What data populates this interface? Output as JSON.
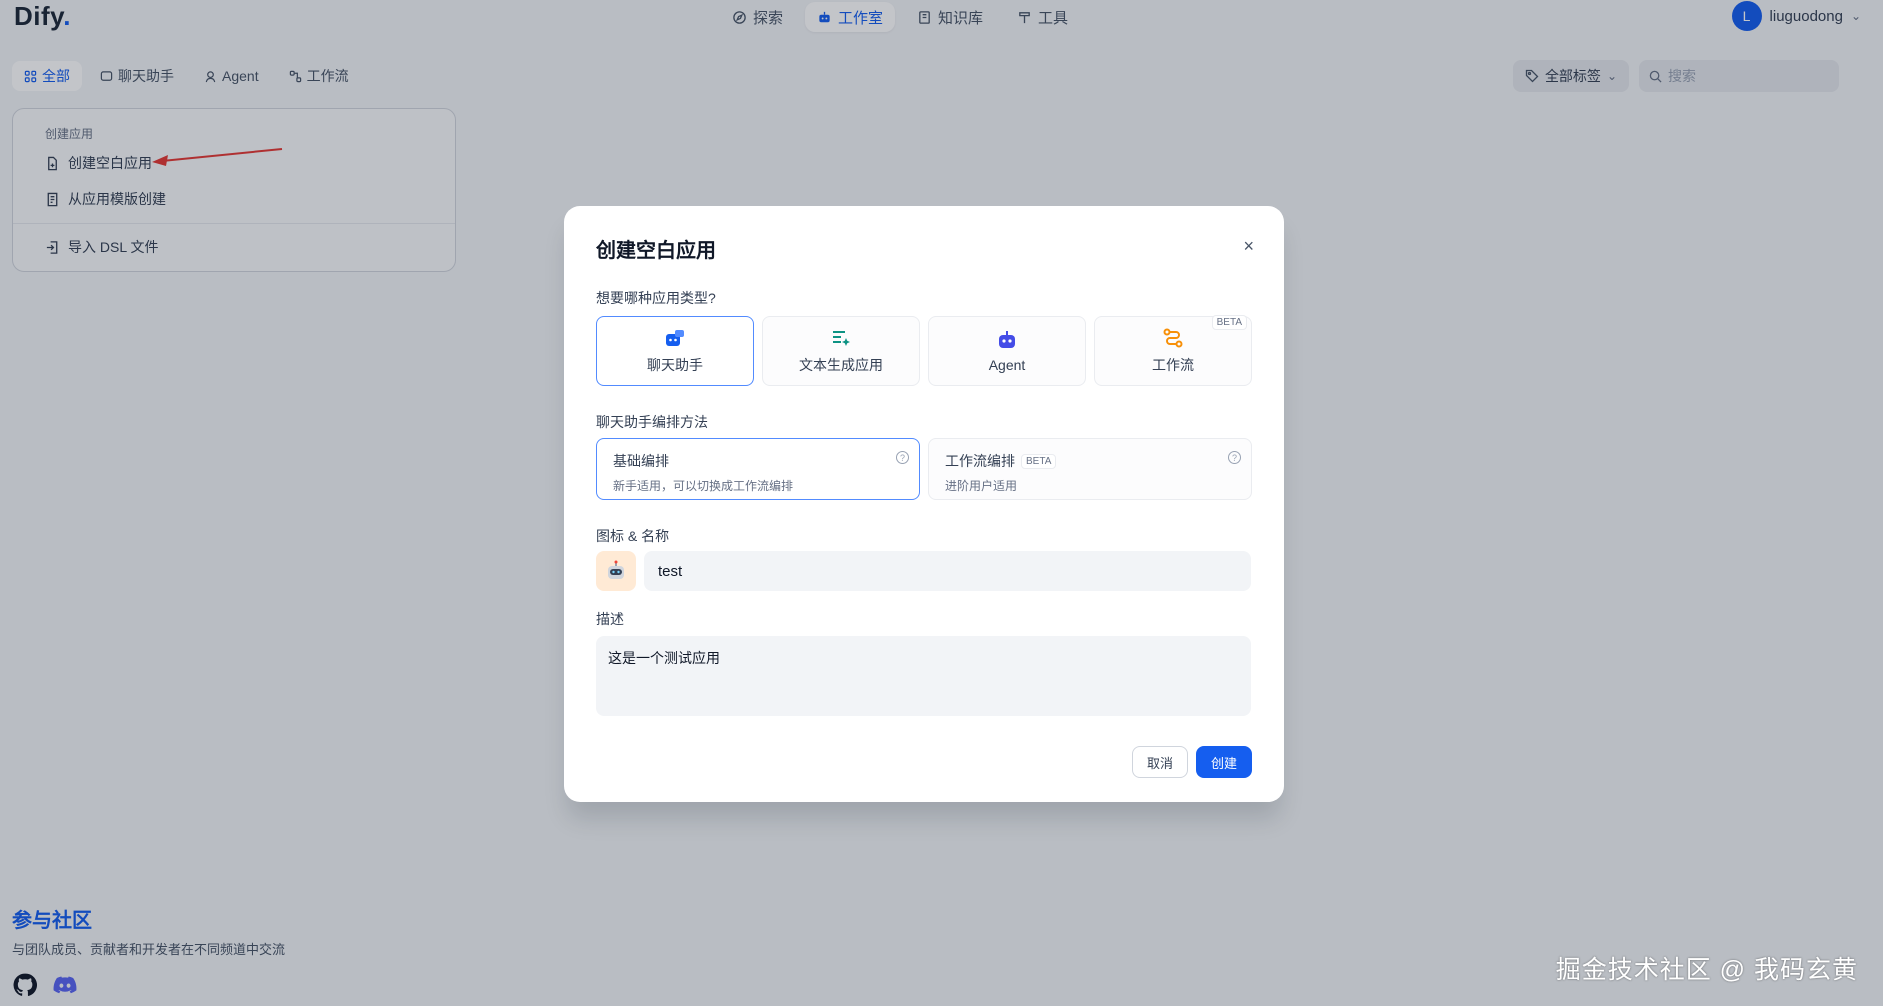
{
  "app": {
    "logo_text": "Dify",
    "logo_dot": "."
  },
  "nav": {
    "items": [
      {
        "label": "探索",
        "icon": "compass-icon"
      },
      {
        "label": "工作室",
        "icon": "robot-icon",
        "active": true
      },
      {
        "label": "知识库",
        "icon": "book-icon"
      },
      {
        "label": "工具",
        "icon": "hammer-icon"
      }
    ]
  },
  "user": {
    "initial": "L",
    "name": "liuguodong"
  },
  "tabs": [
    {
      "label": "全部",
      "active": true
    },
    {
      "label": "聊天助手"
    },
    {
      "label": "Agent"
    },
    {
      "label": "工作流"
    }
  ],
  "filters": {
    "tag_label": "全部标签",
    "search_placeholder": "搜索"
  },
  "create_card": {
    "title": "创建应用",
    "items": [
      "创建空白应用",
      "从应用模版创建",
      "导入 DSL 文件"
    ]
  },
  "community": {
    "title": "参与社区",
    "subtitle": "与团队成员、贡献者和开发者在不同频道中交流"
  },
  "watermark": "掘金技术社区 @ 我码玄黄",
  "modal": {
    "title": "创建空白应用",
    "close": "×",
    "type_question": "想要哪种应用类型?",
    "types": [
      {
        "label": "聊天助手",
        "active": true
      },
      {
        "label": "文本生成应用"
      },
      {
        "label": "Agent"
      },
      {
        "label": "工作流",
        "beta": "BETA"
      }
    ],
    "mode_label": "聊天助手编排方法",
    "modes": [
      {
        "title": "基础编排",
        "desc": "新手适用，可以切换成工作流编排",
        "active": true
      },
      {
        "title": "工作流编排",
        "beta": "BETA",
        "desc": "进阶用户适用"
      }
    ],
    "help": "?",
    "icon_name_label": "图标 & 名称",
    "name_value": "test",
    "desc_label": "描述",
    "desc_value": "这是一个测试应用",
    "cancel": "取消",
    "create": "创建"
  },
  "colors": {
    "accent": "#155eef",
    "overlay": "rgba(16,24,40,0.25)"
  }
}
